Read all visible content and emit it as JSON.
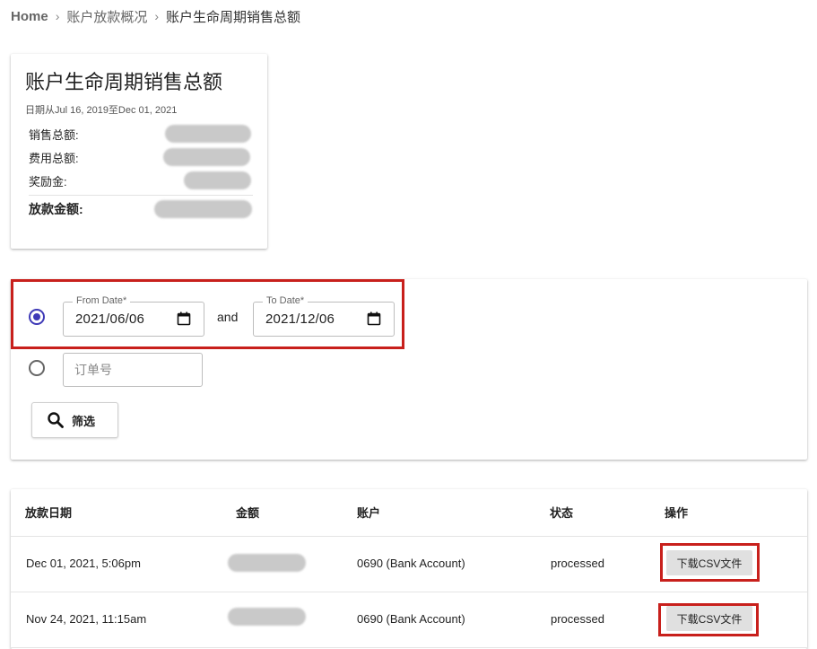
{
  "breadcrumb": {
    "home": "Home",
    "overview": "账户放款概况",
    "current": "账户生命周期销售总额",
    "separator": "›"
  },
  "summary": {
    "title": "账户生命周期销售总额",
    "date_range": "日期从Jul 16, 2019至Dec 01, 2021",
    "rows": [
      {
        "label": "销售总额:"
      },
      {
        "label": "费用总额:"
      },
      {
        "label": "奖励金:"
      }
    ],
    "total_label": "放款金额:"
  },
  "filter": {
    "from_date_label": "From Date",
    "from_date_value": "2021/06/06",
    "and_label": "and",
    "to_date_label": "To Date",
    "to_date_value": "2021/12/06",
    "required_mark": "*",
    "order_placeholder": "订单号",
    "filter_button_label": "筛选",
    "date_mode_selected": true
  },
  "table": {
    "headers": [
      "放款日期",
      "金额",
      "账户",
      "状态",
      "操作"
    ],
    "rows": [
      {
        "date": "Dec 01, 2021, 5:06pm",
        "account": "0690 (Bank Account)",
        "status": "processed",
        "action": "下载CSV文件"
      },
      {
        "date": "Nov 24, 2021, 11:15am",
        "account": "0690 (Bank Account)",
        "status": "processed",
        "action": "下载CSV文件"
      }
    ]
  },
  "colors": {
    "accent": "#3f3ab7",
    "highlight": "#c8201c",
    "redacted": "#c9c9c9"
  }
}
